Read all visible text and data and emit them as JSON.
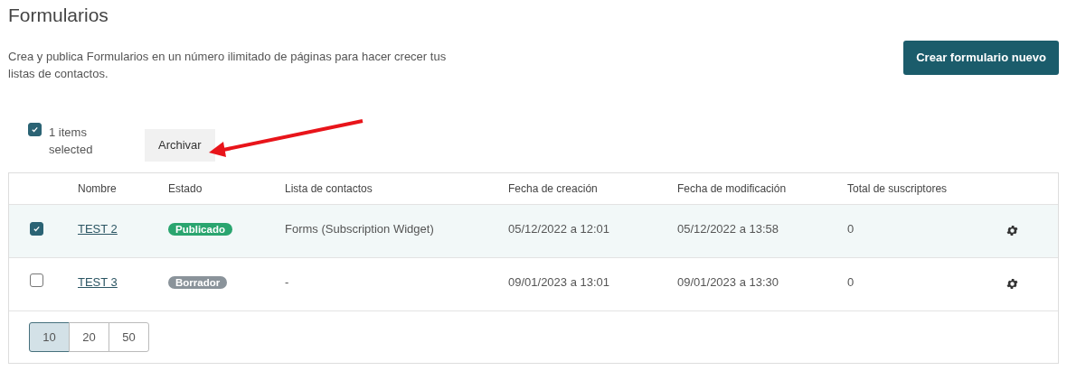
{
  "page": {
    "title": "Formularios",
    "description": "Crea y publica Formularios en un número ilimitado de páginas para hacer crecer tus listas de contactos.",
    "create_button": "Crear formulario nuevo"
  },
  "selection": {
    "checked": true,
    "count_label": "1 items selected",
    "archive_button": "Archivar"
  },
  "table": {
    "columns": [
      "Nombre",
      "Estado",
      "Lista de contactos",
      "Fecha de creación",
      "Fecha de modificación",
      "Total de suscriptores"
    ],
    "rows": [
      {
        "selected": true,
        "name": "TEST 2",
        "status": "Publicado",
        "color": "#2aa56f",
        "contact_list": "Forms (Subscription Widget)",
        "created": "05/12/2022 a 12:01",
        "modified": "05/12/2022 a 13:58",
        "subscribers": "0"
      },
      {
        "selected": false,
        "name": "TEST 3",
        "status": "Borrador",
        "color": "#8a939a",
        "contact_list": "-",
        "created": "09/01/2023 a 13:01",
        "modified": "09/01/2023 a 13:30",
        "subscribers": "0"
      }
    ]
  },
  "page_sizes": [
    {
      "label": "10",
      "selected": true
    },
    {
      "label": "20",
      "selected": false
    },
    {
      "label": "50",
      "selected": false
    }
  ]
}
